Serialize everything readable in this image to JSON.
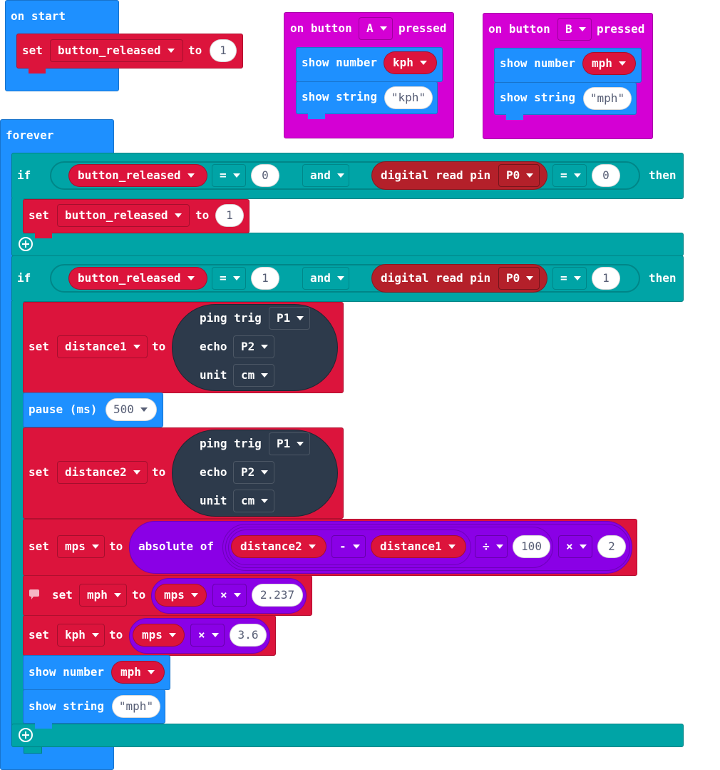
{
  "on_start": {
    "label": "on start",
    "set_label": "set",
    "var": "button_released",
    "to_label": "to",
    "value": "1"
  },
  "button_a": {
    "prefix": "on button",
    "button": "A",
    "suffix": "pressed",
    "show_number_label": "show number",
    "number_var": "kph",
    "show_string_label": "show string",
    "string_value": "\"kph\""
  },
  "button_b": {
    "prefix": "on button",
    "button": "B",
    "suffix": "pressed",
    "show_number_label": "show number",
    "number_var": "mph",
    "show_string_label": "show string",
    "string_value": "\"mph\""
  },
  "forever": {
    "label": "forever",
    "if1": {
      "if_label": "if",
      "var": "button_released",
      "op1": "=",
      "val1": "0",
      "and_label": "and",
      "read_label": "digital read pin",
      "pin": "P0",
      "op2": "=",
      "val2": "0",
      "then_label": "then",
      "set_label": "set",
      "set_var": "button_released",
      "to_label": "to",
      "set_value": "1"
    },
    "if2": {
      "if_label": "if",
      "var": "button_released",
      "op1": "=",
      "val1": "1",
      "and_label": "and",
      "read_label": "digital read pin",
      "pin": "P0",
      "op2": "=",
      "val2": "1",
      "then_label": "then"
    },
    "set_distance1": {
      "set_label": "set",
      "var": "distance1",
      "to_label": "to",
      "ping_label": "ping trig",
      "trig": "P1",
      "echo_label": "echo",
      "echo": "P2",
      "unit_label": "unit",
      "unit": "cm"
    },
    "pause": {
      "label": "pause (ms)",
      "value": "500"
    },
    "set_distance2": {
      "set_label": "set",
      "var": "distance2",
      "to_label": "to",
      "ping_label": "ping trig",
      "trig": "P1",
      "echo_label": "echo",
      "echo": "P2",
      "unit_label": "unit",
      "unit": "cm"
    },
    "set_mps": {
      "set_label": "set",
      "var": "mps",
      "to_label": "to",
      "abs_label": "absolute of",
      "lhs": "distance2",
      "minus": "-",
      "rhs": "distance1",
      "div": "÷",
      "div_value": "100",
      "mul": "×",
      "mul_value": "2"
    },
    "set_mph": {
      "set_label": "set",
      "var": "mph",
      "to_label": "to",
      "src": "mps",
      "op": "×",
      "factor": "2.237"
    },
    "set_kph": {
      "set_label": "set",
      "var": "kph",
      "to_label": "to",
      "src": "mps",
      "op": "×",
      "factor": "3.6"
    },
    "show_number": {
      "label": "show number",
      "var": "mph"
    },
    "show_string": {
      "label": "show string",
      "value": "\"mph\""
    }
  },
  "colors": {
    "basic": "#1e90ff",
    "variables": "#dc143c",
    "input": "#d400d4",
    "logic": "#00a4a6",
    "math": "#8a00e6",
    "sonar": "#2d3a4b",
    "pins": "#b4202a"
  },
  "icons": [
    "caret-down-icon",
    "add-icon",
    "comment-icon"
  ]
}
